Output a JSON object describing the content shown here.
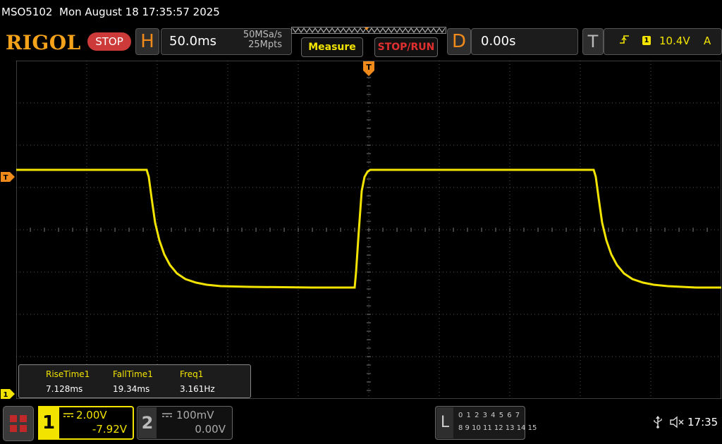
{
  "topline": {
    "model": "MSO5102",
    "datetime": "Mon August 18 17:35:57 2025"
  },
  "header": {
    "logo": "RIGOL",
    "run_state": "STOP",
    "horizontal": {
      "letter": "H",
      "timebase": "50.0ms",
      "sample_rate": "50MSa/s",
      "memory_depth": "25Mpts"
    },
    "measure_label": "Measure",
    "stoprun_label": "STOP/RUN",
    "delay": {
      "letter": "D",
      "value": "0.00s"
    },
    "trigger": {
      "letter": "T",
      "channel": "1",
      "level": "10.4V",
      "mode": "A"
    }
  },
  "markers": {
    "trigger_top": "T",
    "trigger_left": "T",
    "ch1_ground": "1"
  },
  "measurements": [
    {
      "label": "RiseTime1",
      "value": "7.128ms"
    },
    {
      "label": "FallTime1",
      "value": "19.34ms"
    },
    {
      "label": "Freq1",
      "value": "3.161Hz"
    }
  ],
  "channels": [
    {
      "number": "1",
      "scale": "2.00V",
      "offset": "-7.92V",
      "active": true
    },
    {
      "number": "2",
      "scale": "100mV",
      "offset": "0.00V",
      "active": false
    }
  ],
  "logic_analyzer": {
    "letter": "L",
    "row1": "0 1 2 3  4 5 6 7",
    "row2": "8 9 10 11 12 13 14 15"
  },
  "status": {
    "clock": "17:35"
  },
  "colors": {
    "ch1": "#f2e400",
    "accent_orange": "#f08a1a",
    "stop_red": "#cc3a3a"
  },
  "icons": [
    "menu-icon",
    "usb-icon",
    "speaker-muted-icon"
  ]
}
